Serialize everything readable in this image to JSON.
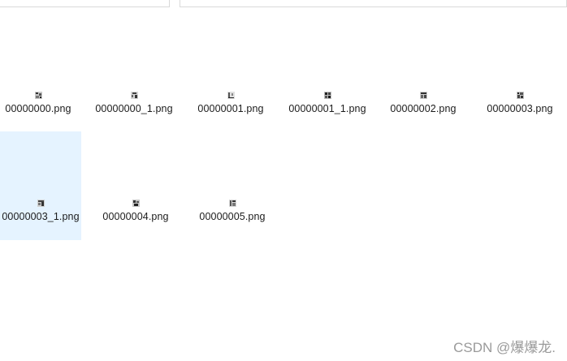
{
  "files": [
    {
      "name": "00000000.png"
    },
    {
      "name": "00000000_1.png"
    },
    {
      "name": "00000001.png"
    },
    {
      "name": "00000001_1.png"
    },
    {
      "name": "00000002.png"
    },
    {
      "name": "00000003.png"
    },
    {
      "name": "00000003_1.png",
      "selected": true
    },
    {
      "name": "00000004.png"
    },
    {
      "name": "00000005.png"
    }
  ],
  "selection_color": "#e5f3ff",
  "icon": "image-thumbnail-icon",
  "watermark": "CSDN @爆爆龙."
}
